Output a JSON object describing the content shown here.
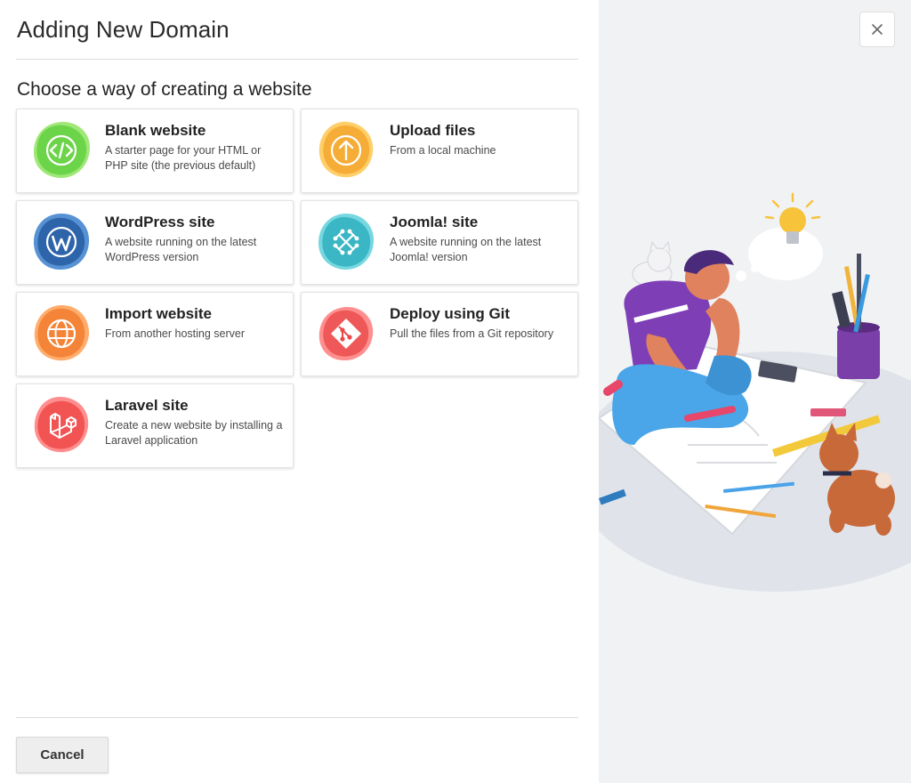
{
  "dialog": {
    "title": "Adding New Domain",
    "section_title": "Choose a way of creating a website",
    "cancel_label": "Cancel",
    "close_label": "×"
  },
  "options": [
    {
      "title": "Blank website",
      "description": "A starter page for your HTML or PHP site (the previous default)",
      "icon": "code-icon",
      "color": "#6fd64a"
    },
    {
      "title": "Upload files",
      "description": "From a local machine",
      "icon": "upload-icon",
      "color": "#f7b23b"
    },
    {
      "title": "WordPress site",
      "description": "A website running on the latest WordPress version",
      "icon": "wordpress-icon",
      "color": "#2f6db5"
    },
    {
      "title": "Joomla! site",
      "description": "A website running on the latest Joomla! version",
      "icon": "joomla-icon",
      "color": "#39bccb"
    },
    {
      "title": "Import website",
      "description": "From another hosting server",
      "icon": "globe-icon",
      "color": "#f5863a"
    },
    {
      "title": "Deploy using Git",
      "description": "Pull the files from a Git repository",
      "icon": "git-icon",
      "color": "#f15a5a"
    },
    {
      "title": "Laravel site",
      "description": "Create a new website by installing a Laravel application",
      "icon": "laravel-icon",
      "color": "#f35454"
    }
  ]
}
